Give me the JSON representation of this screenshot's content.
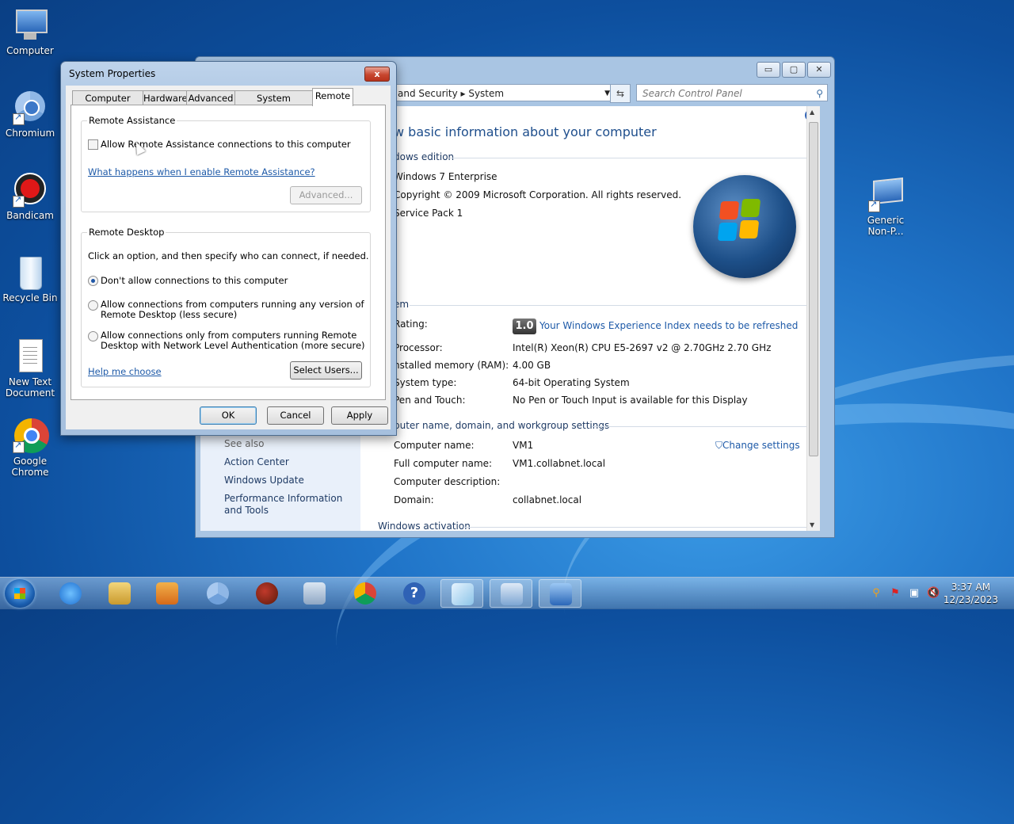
{
  "desktop": {
    "icons": [
      {
        "label": "Computer"
      },
      {
        "label": "Chromium"
      },
      {
        "label": "Bandicam"
      },
      {
        "label": "Recycle Bin"
      },
      {
        "label": "New Text Document"
      },
      {
        "label": "Google Chrome"
      },
      {
        "label": "Generic Non-P..."
      }
    ]
  },
  "control_panel": {
    "address": "and Security  ▸  System",
    "search_placeholder": "Search Control Panel",
    "heading": "w basic information about your computer",
    "edition_header": "dows edition",
    "edition": "Windows 7 Enterprise",
    "copyright": "Copyright © 2009 Microsoft Corporation.  All rights reserved.",
    "service_pack": "Service Pack 1",
    "system_header": "em",
    "rows": [
      {
        "label": "Rating:",
        "value": "Your Windows Experience Index needs to be refreshed"
      },
      {
        "label": "Processor:",
        "value": "Intel(R) Xeon(R) CPU E5-2697 v2 @ 2.70GHz   2.70 GHz"
      },
      {
        "label": "nstalled memory (RAM):",
        "value": "4.00 GB"
      },
      {
        "label": "System type:",
        "value": "64-bit Operating System"
      },
      {
        "label": "Pen and Touch:",
        "value": "No Pen or Touch Input is available for this Display"
      }
    ],
    "wei_score": "1.0",
    "computer_header": "puter name, domain, and workgroup settings",
    "computer_rows": [
      {
        "label": "Computer name:",
        "value": "VM1"
      },
      {
        "label": "Full computer name:",
        "value": "VM1.collabnet.local"
      },
      {
        "label": "Computer description:",
        "value": ""
      },
      {
        "label": "Domain:",
        "value": "collabnet.local"
      }
    ],
    "change_settings": "Change settings",
    "activation_header": "Windows activation",
    "see_also": "See also",
    "left_links": [
      "Action Center",
      "Windows Update",
      "Performance Information and Tools"
    ]
  },
  "dialog": {
    "title": "System Properties",
    "close_label": "x",
    "tabs": [
      "Computer Name",
      "Hardware",
      "Advanced",
      "System Protection",
      "Remote"
    ],
    "active_tab": "Remote",
    "remote_assistance": {
      "group_label": "Remote Assistance",
      "checkbox_label": "Allow Remote Assistance connections to this computer",
      "checked": false,
      "help_link": "What happens when I enable Remote Assistance?",
      "advanced_button": "Advanced..."
    },
    "remote_desktop": {
      "group_label": "Remote Desktop",
      "instruction": "Click an option, and then specify who can connect, if needed.",
      "option1": "Don't allow connections to this computer",
      "option2_line1": "Allow connections from computers running any version of",
      "option2_line2": "Remote Desktop (less secure)",
      "option3_line1": "Allow connections only from computers running Remote",
      "option3_line2": "Desktop with Network Level Authentication (more secure)",
      "selected_option": 1,
      "help_link": "Help me choose",
      "select_users_button": "Select Users..."
    },
    "buttons": {
      "ok": "OK",
      "cancel": "Cancel",
      "apply": "Apply"
    }
  },
  "taskbar": {
    "time": "3:37 AM",
    "date": "12/23/2023"
  },
  "colors": {
    "link": "#1e5aa8",
    "desktop_bg": "#1f73c7",
    "close_button": "#c7472f"
  }
}
